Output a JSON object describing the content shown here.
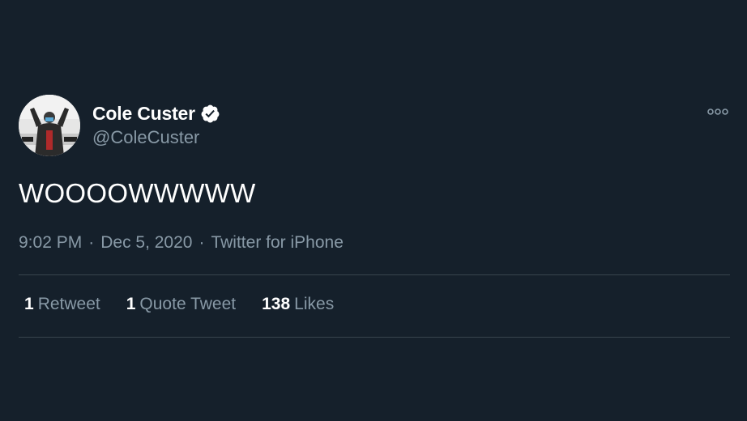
{
  "tweet": {
    "author": {
      "display_name": "Cole Custer",
      "handle": "@ColeCuster",
      "verified": true,
      "avatar_icon": "racer-celebrating-avatar"
    },
    "text": "WOOOOWWWWW",
    "meta": {
      "time": "9:02 PM",
      "date": "Dec 5, 2020",
      "source": "Twitter for iPhone",
      "separator": "·"
    },
    "stats": {
      "retweets": {
        "count": "1",
        "label": "Retweet"
      },
      "quote_tweets": {
        "count": "1",
        "label": "Quote Tweet"
      },
      "likes": {
        "count": "138",
        "label": "Likes"
      }
    },
    "more_icon": "more-horizontal-icon"
  },
  "colors": {
    "background": "#15202b",
    "primary_text": "#ffffff",
    "secondary_text": "#8899a6",
    "divider": "#38444d"
  }
}
